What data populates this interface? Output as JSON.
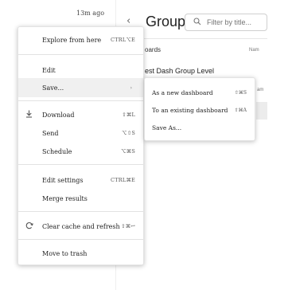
{
  "header": {
    "timestamp": "13m ago",
    "back_icon": "chevron-left-icon",
    "title": "Group",
    "filter_placeholder": "Filter by title..."
  },
  "content": {
    "tab_label": "oards",
    "column_name": "Nam",
    "row_title": "est Dash Group Level",
    "row_sub": "am"
  },
  "menu": {
    "explore": {
      "label": "Explore from here",
      "shortcut": "CTRL⌥E"
    },
    "edit": {
      "label": "Edit"
    },
    "save": {
      "label": "Save...",
      "arrow": "›"
    },
    "download": {
      "label": "Download",
      "shortcut": "⇧⌘L",
      "icon": "download-icon"
    },
    "send": {
      "label": "Send",
      "shortcut": "⌥⇧S"
    },
    "schedule": {
      "label": "Schedule",
      "shortcut": "⌥⌘S"
    },
    "edit_settings": {
      "label": "Edit settings",
      "shortcut": "CTRL⌘E"
    },
    "merge_results": {
      "label": "Merge results"
    },
    "clear_cache": {
      "label": "Clear cache and refresh",
      "shortcut": "⇧⌘↩",
      "icon": "refresh-icon"
    },
    "move_to_trash": {
      "label": "Move to trash"
    }
  },
  "submenu": {
    "new_dashboard": {
      "label": "As a new dashboard",
      "shortcut": "⇧⌘S"
    },
    "existing_dashboard": {
      "label": "To an existing dashboard",
      "shortcut": "⇧⌘A"
    },
    "save_as": {
      "label": "Save As..."
    }
  }
}
